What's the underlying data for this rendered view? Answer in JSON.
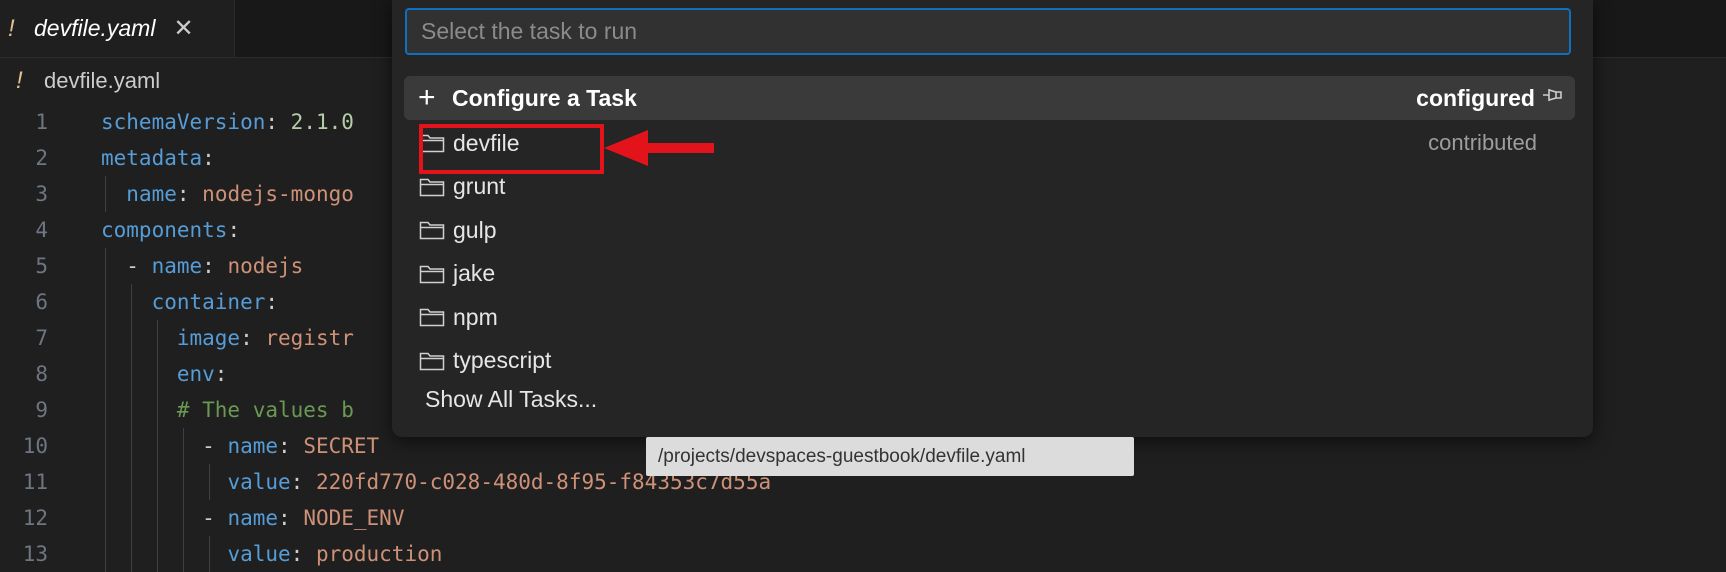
{
  "tab": {
    "icon": "!",
    "filename": "devfile.yaml",
    "close": "✕"
  },
  "breadcrumb": {
    "icon": "!",
    "text": "devfile.yaml"
  },
  "code": {
    "lines": [
      {
        "n": "1",
        "parts": [
          [
            "schemaVersion",
            "key"
          ],
          [
            ": ",
            "pun"
          ],
          [
            "2.1.0",
            "num"
          ]
        ]
      },
      {
        "n": "2",
        "parts": [
          [
            "metadata",
            "key"
          ],
          [
            ":",
            "pun"
          ]
        ]
      },
      {
        "n": "3",
        "parts": [
          [
            "  ",
            "pun"
          ],
          [
            "name",
            "key"
          ],
          [
            ": ",
            "pun"
          ],
          [
            "nodejs-mongo",
            "val"
          ]
        ]
      },
      {
        "n": "4",
        "parts": [
          [
            "components",
            "key"
          ],
          [
            ":",
            "pun"
          ]
        ]
      },
      {
        "n": "5",
        "parts": [
          [
            "  - ",
            "pun"
          ],
          [
            "name",
            "key"
          ],
          [
            ": ",
            "pun"
          ],
          [
            "nodejs",
            "val"
          ]
        ]
      },
      {
        "n": "6",
        "parts": [
          [
            "    ",
            "pun"
          ],
          [
            "container",
            "key"
          ],
          [
            ":",
            "pun"
          ]
        ]
      },
      {
        "n": "7",
        "parts": [
          [
            "      ",
            "pun"
          ],
          [
            "image",
            "key"
          ],
          [
            ": ",
            "pun"
          ],
          [
            "registr",
            "val"
          ]
        ]
      },
      {
        "n": "8",
        "parts": [
          [
            "      ",
            "pun"
          ],
          [
            "env",
            "key"
          ],
          [
            ":",
            "pun"
          ]
        ]
      },
      {
        "n": "9",
        "parts": [
          [
            "      ",
            "pun"
          ],
          [
            "# The values b",
            "com"
          ]
        ]
      },
      {
        "n": "10",
        "parts": [
          [
            "        - ",
            "pun"
          ],
          [
            "name",
            "key"
          ],
          [
            ": ",
            "pun"
          ],
          [
            "SECRET",
            "val"
          ]
        ]
      },
      {
        "n": "11",
        "parts": [
          [
            "          ",
            "pun"
          ],
          [
            "value",
            "key"
          ],
          [
            ": ",
            "pun"
          ],
          [
            "220fd770-c028-480d-8f95-f84353c7d55a",
            "val"
          ]
        ]
      },
      {
        "n": "12",
        "parts": [
          [
            "        - ",
            "pun"
          ],
          [
            "name",
            "key"
          ],
          [
            ": ",
            "pun"
          ],
          [
            "NODE_ENV",
            "val"
          ]
        ]
      },
      {
        "n": "13",
        "parts": [
          [
            "          ",
            "pun"
          ],
          [
            "value",
            "key"
          ],
          [
            ": ",
            "pun"
          ],
          [
            "production",
            "val"
          ]
        ]
      }
    ]
  },
  "quickpick": {
    "placeholder": "Select the task to run",
    "configure": {
      "icon": "+",
      "label": "Configure a Task",
      "group": "configured",
      "pin_icon": "pin-icon"
    },
    "tasks": [
      {
        "label": "devfile",
        "desc": "contributed"
      },
      {
        "label": "grunt",
        "desc": ""
      },
      {
        "label": "gulp",
        "desc": ""
      },
      {
        "label": "jake",
        "desc": ""
      },
      {
        "label": "npm",
        "desc": ""
      },
      {
        "label": "typescript",
        "desc": ""
      }
    ],
    "show_all": "Show All Tasks..."
  },
  "tooltip": "/projects/devspaces-guestbook/devfile.yaml",
  "colors": {
    "accent": "#0e70c0",
    "highlight": "#e3131b",
    "background": "#1f1f1f",
    "panel": "#252526"
  }
}
